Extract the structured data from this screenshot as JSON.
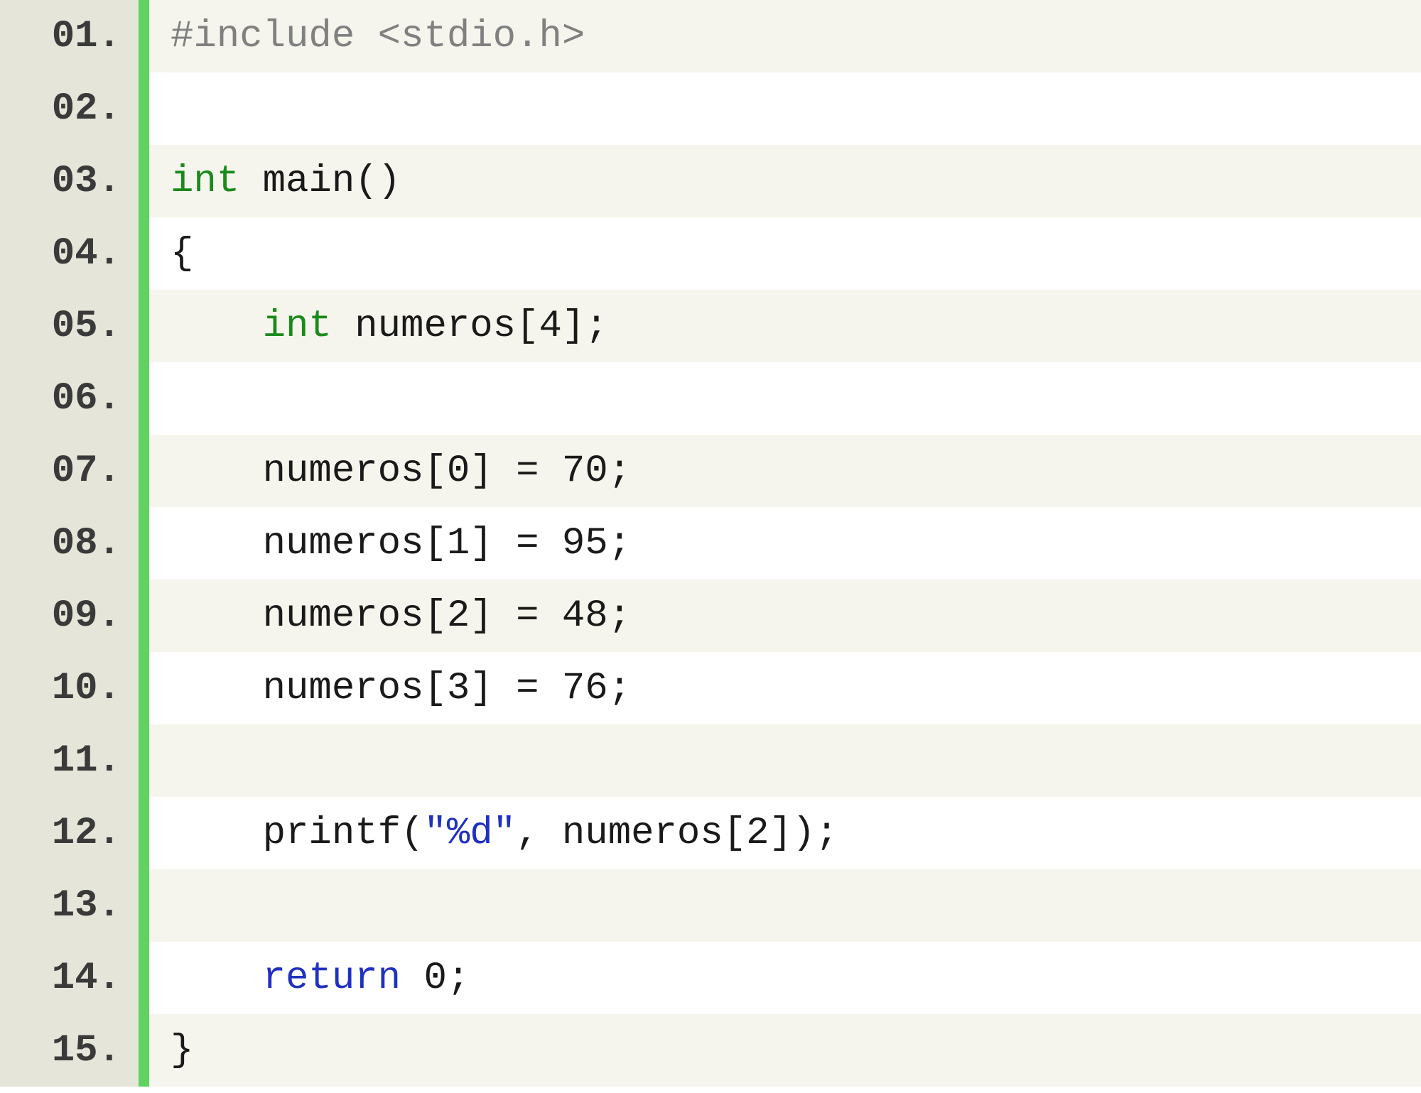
{
  "lines": [
    {
      "num": "01.",
      "tokens": [
        {
          "cls": "tok-preproc",
          "text": "#include <stdio.h>"
        }
      ]
    },
    {
      "num": "02.",
      "tokens": []
    },
    {
      "num": "03.",
      "tokens": [
        {
          "cls": "tok-keyword",
          "text": "int"
        },
        {
          "cls": "tok-default",
          "text": " main()"
        }
      ]
    },
    {
      "num": "04.",
      "tokens": [
        {
          "cls": "tok-default",
          "text": "{"
        }
      ]
    },
    {
      "num": "05.",
      "tokens": [
        {
          "cls": "tok-default",
          "text": "    "
        },
        {
          "cls": "tok-keyword",
          "text": "int"
        },
        {
          "cls": "tok-default",
          "text": " numeros[4];"
        }
      ]
    },
    {
      "num": "06.",
      "tokens": []
    },
    {
      "num": "07.",
      "tokens": [
        {
          "cls": "tok-default",
          "text": "    numeros[0] = 70;"
        }
      ]
    },
    {
      "num": "08.",
      "tokens": [
        {
          "cls": "tok-default",
          "text": "    numeros[1] = 95;"
        }
      ]
    },
    {
      "num": "09.",
      "tokens": [
        {
          "cls": "tok-default",
          "text": "    numeros[2] = 48;"
        }
      ]
    },
    {
      "num": "10.",
      "tokens": [
        {
          "cls": "tok-default",
          "text": "    numeros[3] = 76;"
        }
      ]
    },
    {
      "num": "11.",
      "tokens": []
    },
    {
      "num": "12.",
      "tokens": [
        {
          "cls": "tok-default",
          "text": "    printf("
        },
        {
          "cls": "tok-string",
          "text": "\"%d\""
        },
        {
          "cls": "tok-default",
          "text": ", numeros[2]);"
        }
      ]
    },
    {
      "num": "13.",
      "tokens": []
    },
    {
      "num": "14.",
      "tokens": [
        {
          "cls": "tok-default",
          "text": "    "
        },
        {
          "cls": "tok-keyword-flow",
          "text": "return"
        },
        {
          "cls": "tok-default",
          "text": " 0;"
        }
      ]
    },
    {
      "num": "15.",
      "tokens": [
        {
          "cls": "tok-default",
          "text": "}"
        }
      ]
    }
  ]
}
